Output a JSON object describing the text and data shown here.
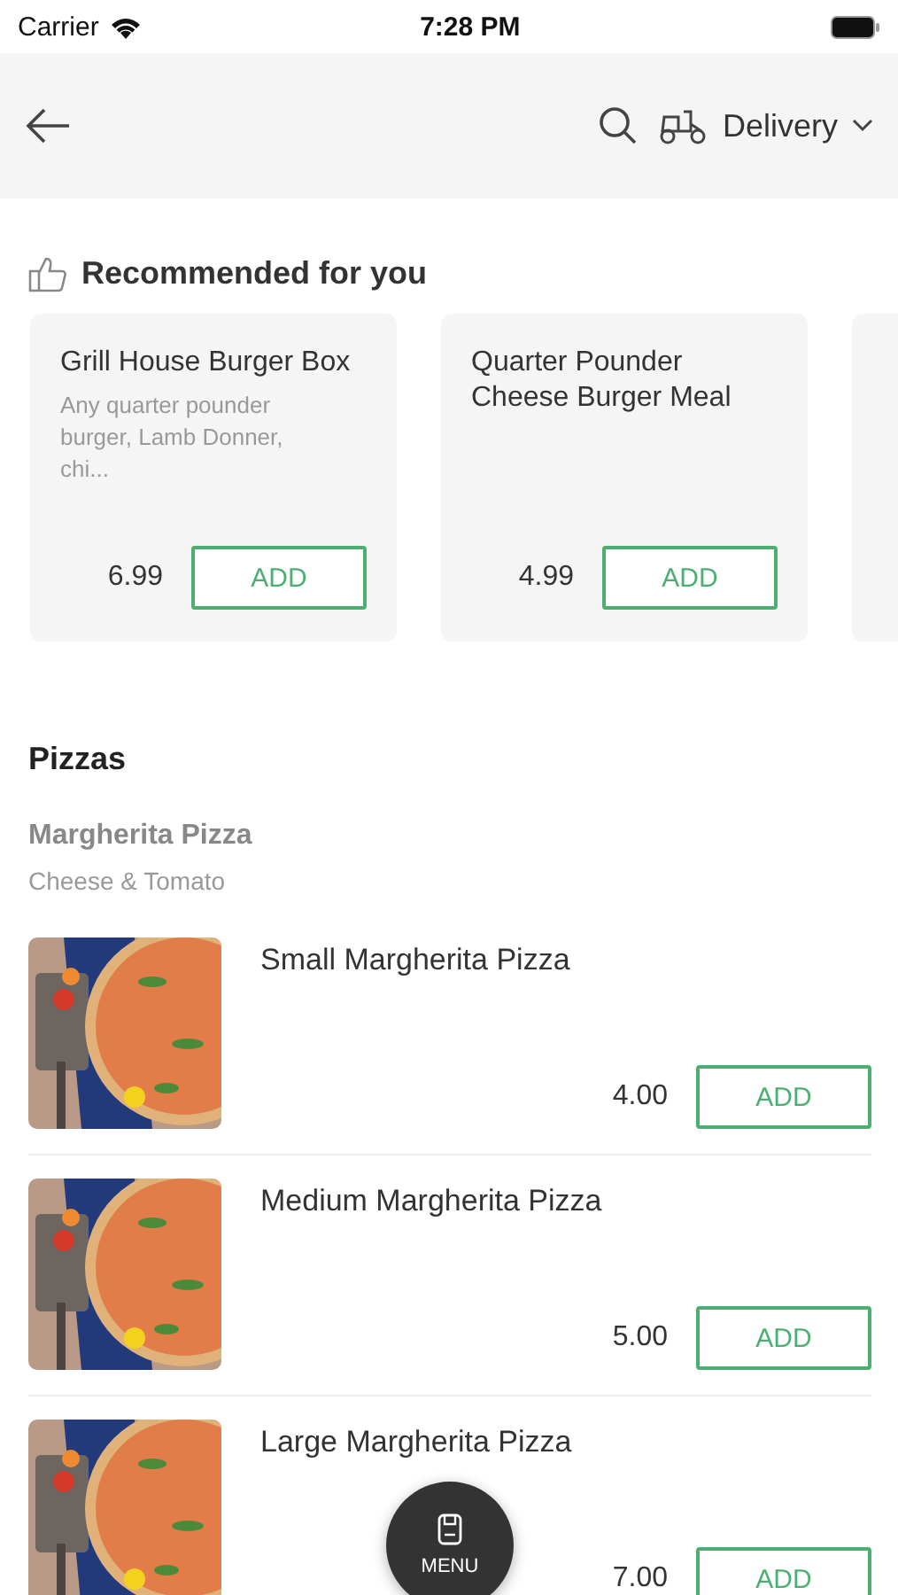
{
  "status_bar": {
    "carrier": "Carrier",
    "time": "7:28 PM"
  },
  "header": {
    "order_mode": "Delivery"
  },
  "recommended": {
    "title": "Recommended for you",
    "items": [
      {
        "name": "Grill House Burger Box",
        "description": "Any quarter pounder burger, Lamb Donner, chi...",
        "price": "6.99",
        "button": "ADD"
      },
      {
        "name": "Quarter Pounder Cheese Burger Meal",
        "price": "4.99",
        "button": "ADD"
      }
    ]
  },
  "category": {
    "title": "Pizzas",
    "subtitle": "Margherita Pizza",
    "subtitle_description": "Cheese & Tomato",
    "items": [
      {
        "name": "Small Margherita Pizza",
        "price": "4.00",
        "button": "ADD"
      },
      {
        "name": "Medium Margherita Pizza",
        "price": "5.00",
        "button": "ADD"
      },
      {
        "name": "Large Margherita Pizza",
        "price": "7.00",
        "button": "ADD"
      }
    ]
  },
  "menu_button": {
    "label": "MENU"
  }
}
